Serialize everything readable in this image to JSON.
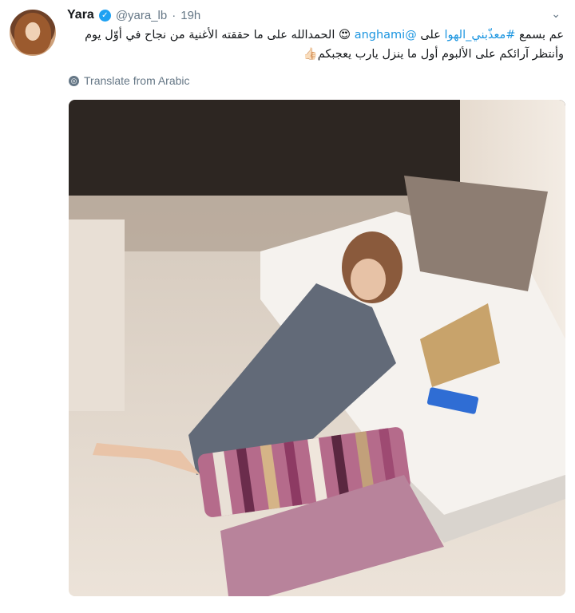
{
  "tweet": {
    "author_name": "Yara",
    "verified_icon": "verified-badge-icon",
    "handle": "@yara_lb",
    "separator": "·",
    "time": "19h",
    "line1_part1": "عم بسمع ",
    "hashtag": "#معذّبني_الهوا",
    "line1_part2": " على ",
    "mention": "@anghami",
    "line1_part3": " الحمدالله على ما حققته الأغنية من نجاح في أوّل يوم",
    "line2": "وأنتظر آرائكم على الألبوم أول ما ينزل يارب يعجبكم",
    "emoji_love": "😍",
    "emoji_thumb": "👍🏻",
    "translate_label": "Translate from Arabic",
    "photo_alt": "Woman lying on floor beside white sofa using a tablet",
    "accent_color": "#1b95e0"
  }
}
